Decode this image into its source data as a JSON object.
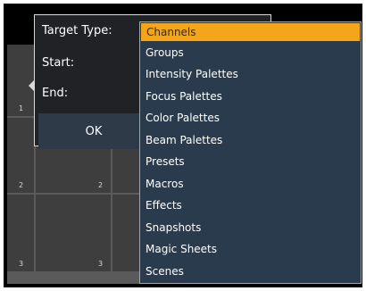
{
  "dialog": {
    "target_type_label": "Target Type:",
    "start_label": "Start:",
    "end_label": "End:",
    "ok_label": "OK"
  },
  "dropdown": {
    "selected": "Channels",
    "options": [
      "Groups",
      "Intensity Palettes",
      "Focus Palettes",
      "Color Palettes",
      "Beam Palettes",
      "Presets",
      "Macros",
      "Effects",
      "Snapshots",
      "Magic Sheets",
      "Scenes"
    ]
  },
  "background_cells": {
    "row_marks": [
      "1",
      "2",
      "3"
    ]
  },
  "colors": {
    "accent": "#f3a51c",
    "dropdown_bg": "#2a3b4d",
    "dialog_bg": "#202226",
    "button_bg": "#2e3a48"
  }
}
